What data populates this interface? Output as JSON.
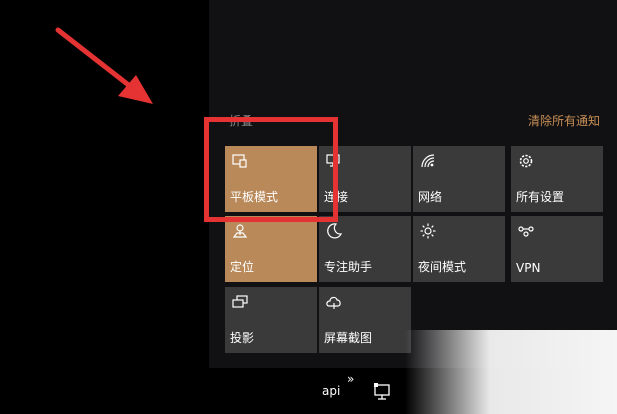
{
  "header": {
    "collapse_label": "折叠",
    "clear_all": "清除所有通知"
  },
  "tiles": [
    {
      "label": "平板模式",
      "icon": "tablet-mode-icon",
      "active": true
    },
    {
      "label": "连接",
      "icon": "connect-icon",
      "active": false
    },
    {
      "label": "网络",
      "icon": "network-icon",
      "active": false
    },
    {
      "label": "所有设置",
      "icon": "gear-icon",
      "active": false
    },
    {
      "label": "定位",
      "icon": "location-icon",
      "active": true
    },
    {
      "label": "专注助手",
      "icon": "moon-icon",
      "active": false
    },
    {
      "label": "夜间模式",
      "icon": "brightness-icon",
      "active": false
    },
    {
      "label": "VPN",
      "icon": "vpn-icon",
      "active": false
    },
    {
      "label": "投影",
      "icon": "project-icon",
      "active": false
    },
    {
      "label": "屏幕截图",
      "icon": "screen-snip-icon",
      "active": false
    }
  ],
  "taskbar": {
    "text": "api",
    "chevron": "»"
  },
  "colors": {
    "active_tile": "#b9895a",
    "inactive_tile": "#3a3a3a",
    "accent_link": "#c98f56",
    "highlight": "#e53333"
  }
}
